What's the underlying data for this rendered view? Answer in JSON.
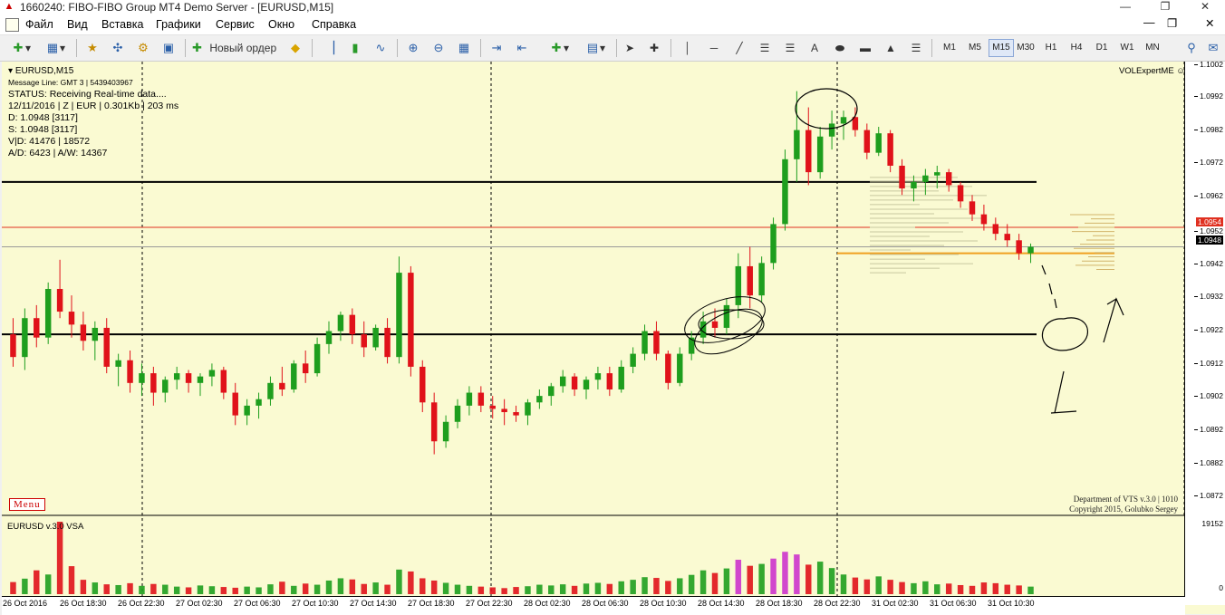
{
  "window": {
    "title": "1660240: FIBO-FIBO Group MT4 Demo Server - [EURUSD,M15]"
  },
  "menu": [
    "Файл",
    "Вид",
    "Вставка",
    "Графики",
    "Сервис",
    "Окно",
    "Справка"
  ],
  "toolbar": {
    "new_order_label": "Новый ордер",
    "timeframes": [
      "M1",
      "M5",
      "M15",
      "M30",
      "H1",
      "H4",
      "D1",
      "W1",
      "MN"
    ],
    "active_timeframe": "M15"
  },
  "chart": {
    "symbol_label": "EURUSD,M15",
    "message_line": "Message Line: GMT 3 | 5439403967",
    "status": "STATUS:  Receiving Real-time data....",
    "info_line": "12/11/2016 | Z | EUR | 0.301Kb | 203 ms",
    "d_line": "D: 1.0948  [3117]",
    "s_line": "S: 1.0948  [3117]",
    "vd_line": "V|D: 41476 | 18572",
    "ad_line": "A/D: 6423 | A/W: 14367",
    "expert": "VOLExpertME",
    "menu_button": "Menu",
    "copyright_1": "Department of VTS  v.3.0 | 1010",
    "copyright_2": "Copyright 2015, Golubko Sergey",
    "indicator_label": "EURUSD v.3.0 VSA",
    "volume_max_label": "19152",
    "volume_zero_label": "0",
    "price_labels": [
      "1.1002",
      "1.0992",
      "1.0982",
      "1.0972",
      "1.0962",
      "1.0952",
      "1.0942",
      "1.0932",
      "1.0922",
      "1.0912",
      "1.0902",
      "1.0892",
      "1.0882",
      "1.0872"
    ],
    "red_line_tag": "1.0954",
    "bid_tag": "1.0948",
    "time_labels": [
      "26 Oct 2016",
      "26 Oct 18:30",
      "26 Oct 22:30",
      "27 Oct 02:30",
      "27 Oct 06:30",
      "27 Oct 10:30",
      "27 Oct 14:30",
      "27 Oct 18:30",
      "27 Oct 22:30",
      "28 Oct 02:30",
      "28 Oct 06:30",
      "28 Oct 10:30",
      "28 Oct 14:30",
      "28 Oct 18:30",
      "28 Oct 22:30",
      "31 Oct 02:30",
      "31 Oct 06:30",
      "31 Oct 10:30"
    ],
    "colors": {
      "background": "#FAFAD2",
      "bull": "#1E9E1E",
      "bear": "#E0121A",
      "bull_light": "#7CDD7C",
      "vol_climax": "#CC33CC",
      "level_line": "#000000",
      "red_level": "#E03020",
      "orange_level": "#F0A020"
    }
  },
  "chart_data": {
    "type": "candlestick",
    "ylim": [
      1.0866,
      1.1004
    ],
    "horizontal_levels": {
      "resistance": 1.0968,
      "support": 1.0921,
      "red_line": 1.0954,
      "bid": 1.0948,
      "orange": 1.0946
    },
    "candles": [
      {
        "o": 1.0921,
        "h": 1.0926,
        "l": 1.0911,
        "c": 1.0914
      },
      {
        "o": 1.0914,
        "h": 1.0929,
        "l": 1.091,
        "c": 1.0926
      },
      {
        "o": 1.0926,
        "h": 1.093,
        "l": 1.0917,
        "c": 1.092
      },
      {
        "o": 1.092,
        "h": 1.0937,
        "l": 1.0918,
        "c": 1.0935
      },
      {
        "o": 1.0935,
        "h": 1.0944,
        "l": 1.0926,
        "c": 1.0928
      },
      {
        "o": 1.0928,
        "h": 1.0933,
        "l": 1.092,
        "c": 1.0924
      },
      {
        "o": 1.0924,
        "h": 1.0928,
        "l": 1.0916,
        "c": 1.0919
      },
      {
        "o": 1.0919,
        "h": 1.0925,
        "l": 1.0913,
        "c": 1.0923
      },
      {
        "o": 1.0923,
        "h": 1.0926,
        "l": 1.0909,
        "c": 1.0911
      },
      {
        "o": 1.0911,
        "h": 1.0915,
        "l": 1.0905,
        "c": 1.0913
      },
      {
        "o": 1.0913,
        "h": 1.0916,
        "l": 1.0903,
        "c": 1.0906
      },
      {
        "o": 1.0906,
        "h": 1.0912,
        "l": 1.0902,
        "c": 1.0909
      },
      {
        "o": 1.0909,
        "h": 1.0911,
        "l": 1.0899,
        "c": 1.0903
      },
      {
        "o": 1.0903,
        "h": 1.0908,
        "l": 1.09,
        "c": 1.0907
      },
      {
        "o": 1.0907,
        "h": 1.0911,
        "l": 1.0904,
        "c": 1.0909
      },
      {
        "o": 1.0909,
        "h": 1.091,
        "l": 1.0903,
        "c": 1.0906
      },
      {
        "o": 1.0906,
        "h": 1.0909,
        "l": 1.0902,
        "c": 1.0908
      },
      {
        "o": 1.0908,
        "h": 1.0912,
        "l": 1.0905,
        "c": 1.091
      },
      {
        "o": 1.091,
        "h": 1.0911,
        "l": 1.0901,
        "c": 1.0903
      },
      {
        "o": 1.0903,
        "h": 1.0906,
        "l": 1.0893,
        "c": 1.0896
      },
      {
        "o": 1.0896,
        "h": 1.0901,
        "l": 1.0893,
        "c": 1.0899
      },
      {
        "o": 1.0899,
        "h": 1.0903,
        "l": 1.0895,
        "c": 1.0901
      },
      {
        "o": 1.0901,
        "h": 1.0908,
        "l": 1.0899,
        "c": 1.0906
      },
      {
        "o": 1.0906,
        "h": 1.0911,
        "l": 1.0902,
        "c": 1.0904
      },
      {
        "o": 1.0904,
        "h": 1.0913,
        "l": 1.0903,
        "c": 1.0912
      },
      {
        "o": 1.0912,
        "h": 1.0916,
        "l": 1.0906,
        "c": 1.0909
      },
      {
        "o": 1.0909,
        "h": 1.092,
        "l": 1.0908,
        "c": 1.0918
      },
      {
        "o": 1.0918,
        "h": 1.0925,
        "l": 1.0915,
        "c": 1.0922
      },
      {
        "o": 1.0922,
        "h": 1.0928,
        "l": 1.0919,
        "c": 1.0927
      },
      {
        "o": 1.0927,
        "h": 1.0929,
        "l": 1.0918,
        "c": 1.0921
      },
      {
        "o": 1.0921,
        "h": 1.0925,
        "l": 1.0914,
        "c": 1.0917
      },
      {
        "o": 1.0917,
        "h": 1.0924,
        "l": 1.0916,
        "c": 1.0923
      },
      {
        "o": 1.0923,
        "h": 1.0926,
        "l": 1.0912,
        "c": 1.0914
      },
      {
        "o": 1.0914,
        "h": 1.0945,
        "l": 1.0912,
        "c": 1.094
      },
      {
        "o": 1.094,
        "h": 1.0942,
        "l": 1.0908,
        "c": 1.0911
      },
      {
        "o": 1.0911,
        "h": 1.0913,
        "l": 1.0897,
        "c": 1.09
      },
      {
        "o": 1.09,
        "h": 1.0903,
        "l": 1.0884,
        "c": 1.0888
      },
      {
        "o": 1.0888,
        "h": 1.0896,
        "l": 1.0886,
        "c": 1.0894
      },
      {
        "o": 1.0894,
        "h": 1.0901,
        "l": 1.0892,
        "c": 1.0899
      },
      {
        "o": 1.0899,
        "h": 1.0905,
        "l": 1.0896,
        "c": 1.0903
      },
      {
        "o": 1.0903,
        "h": 1.0905,
        "l": 1.0897,
        "c": 1.0899
      },
      {
        "o": 1.0899,
        "h": 1.0902,
        "l": 1.0895,
        "c": 1.0898
      },
      {
        "o": 1.0898,
        "h": 1.0901,
        "l": 1.0893,
        "c": 1.0897
      },
      {
        "o": 1.0897,
        "h": 1.0899,
        "l": 1.0894,
        "c": 1.0896
      },
      {
        "o": 1.0896,
        "h": 1.0901,
        "l": 1.0893,
        "c": 1.09
      },
      {
        "o": 1.09,
        "h": 1.0904,
        "l": 1.0898,
        "c": 1.0902
      },
      {
        "o": 1.0902,
        "h": 1.0906,
        "l": 1.0899,
        "c": 1.0905
      },
      {
        "o": 1.0905,
        "h": 1.091,
        "l": 1.0903,
        "c": 1.0908
      },
      {
        "o": 1.0908,
        "h": 1.0909,
        "l": 1.0902,
        "c": 1.0904
      },
      {
        "o": 1.0904,
        "h": 1.0908,
        "l": 1.0901,
        "c": 1.0907
      },
      {
        "o": 1.0907,
        "h": 1.0911,
        "l": 1.0904,
        "c": 1.0909
      },
      {
        "o": 1.0909,
        "h": 1.0911,
        "l": 1.0902,
        "c": 1.0904
      },
      {
        "o": 1.0904,
        "h": 1.0913,
        "l": 1.0903,
        "c": 1.0911
      },
      {
        "o": 1.0911,
        "h": 1.0917,
        "l": 1.0909,
        "c": 1.0915
      },
      {
        "o": 1.0915,
        "h": 1.0924,
        "l": 1.0913,
        "c": 1.0922
      },
      {
        "o": 1.0922,
        "h": 1.0925,
        "l": 1.0913,
        "c": 1.0915
      },
      {
        "o": 1.0915,
        "h": 1.0916,
        "l": 1.0904,
        "c": 1.0906
      },
      {
        "o": 1.0906,
        "h": 1.0917,
        "l": 1.0905,
        "c": 1.0915
      },
      {
        "o": 1.0915,
        "h": 1.0922,
        "l": 1.0913,
        "c": 1.092
      },
      {
        "o": 1.092,
        "h": 1.0928,
        "l": 1.0918,
        "c": 1.0925
      },
      {
        "o": 1.0925,
        "h": 1.0929,
        "l": 1.092,
        "c": 1.0923
      },
      {
        "o": 1.0923,
        "h": 1.0932,
        "l": 1.0921,
        "c": 1.093
      },
      {
        "o": 1.093,
        "h": 1.0946,
        "l": 1.0926,
        "c": 1.0942
      },
      {
        "o": 1.0942,
        "h": 1.0948,
        "l": 1.0929,
        "c": 1.0933
      },
      {
        "o": 1.0933,
        "h": 1.0945,
        "l": 1.0931,
        "c": 1.0943
      },
      {
        "o": 1.0943,
        "h": 1.0957,
        "l": 1.0941,
        "c": 1.0955
      },
      {
        "o": 1.0955,
        "h": 1.0978,
        "l": 1.0953,
        "c": 1.0975
      },
      {
        "o": 1.0975,
        "h": 1.0996,
        "l": 1.0968,
        "c": 1.0984
      },
      {
        "o": 1.0984,
        "h": 1.0991,
        "l": 1.0967,
        "c": 1.0971
      },
      {
        "o": 1.0971,
        "h": 1.0985,
        "l": 1.0969,
        "c": 1.0982
      },
      {
        "o": 1.0982,
        "h": 1.099,
        "l": 1.0978,
        "c": 1.0986
      },
      {
        "o": 1.0986,
        "h": 1.099,
        "l": 1.0981,
        "c": 1.0988
      },
      {
        "o": 1.0988,
        "h": 1.0991,
        "l": 1.0982,
        "c": 1.0984
      },
      {
        "o": 1.0984,
        "h": 1.0986,
        "l": 1.0975,
        "c": 1.0977
      },
      {
        "o": 1.0977,
        "h": 1.0985,
        "l": 1.0976,
        "c": 1.0983
      },
      {
        "o": 1.0983,
        "h": 1.0984,
        "l": 1.0971,
        "c": 1.0973
      },
      {
        "o": 1.0973,
        "h": 1.0975,
        "l": 1.0964,
        "c": 1.0966
      },
      {
        "o": 1.0966,
        "h": 1.097,
        "l": 1.0962,
        "c": 1.0968
      },
      {
        "o": 1.0968,
        "h": 1.0972,
        "l": 1.0964,
        "c": 1.097
      },
      {
        "o": 1.097,
        "h": 1.0973,
        "l": 1.0966,
        "c": 1.0971
      },
      {
        "o": 1.0971,
        "h": 1.0972,
        "l": 1.0965,
        "c": 1.0967
      },
      {
        "o": 1.0967,
        "h": 1.0968,
        "l": 1.096,
        "c": 1.0962
      },
      {
        "o": 1.0962,
        "h": 1.0964,
        "l": 1.0956,
        "c": 1.0958
      },
      {
        "o": 1.0958,
        "h": 1.0961,
        "l": 1.0953,
        "c": 1.0955
      },
      {
        "o": 1.0955,
        "h": 1.0957,
        "l": 1.095,
        "c": 1.0952
      },
      {
        "o": 1.0952,
        "h": 1.0955,
        "l": 1.0948,
        "c": 1.095
      },
      {
        "o": 1.095,
        "h": 1.0952,
        "l": 1.0944,
        "c": 1.0946
      },
      {
        "o": 1.0946,
        "h": 1.0949,
        "l": 1.0943,
        "c": 1.0948
      }
    ],
    "volumes": [
      3200,
      4100,
      6300,
      5200,
      19152,
      7400,
      3800,
      3100,
      2600,
      2400,
      2900,
      2200,
      2700,
      2500,
      2000,
      1800,
      2300,
      2100,
      1900,
      1700,
      2000,
      1800,
      2600,
      3300,
      2200,
      2800,
      2500,
      3600,
      4200,
      3900,
      2700,
      3100,
      2500,
      6500,
      6000,
      4200,
      3600,
      3000,
      2500,
      2200,
      2000,
      1800,
      1600,
      1900,
      2100,
      2500,
      2300,
      2600,
      2200,
      2800,
      3000,
      2700,
      3400,
      3800,
      4500,
      4300,
      3500,
      4200,
      5100,
      6300,
      5600,
      6800,
      9100,
      7500,
      8000,
      9400,
      11200,
      10500,
      7800,
      8600,
      6900,
      5200,
      4400,
      3900,
      4700,
      3800,
      3200,
      2900,
      3400,
      2600,
      2800,
      2400,
      2200,
      3100,
      2900,
      2500,
      2300,
      2000
    ]
  }
}
